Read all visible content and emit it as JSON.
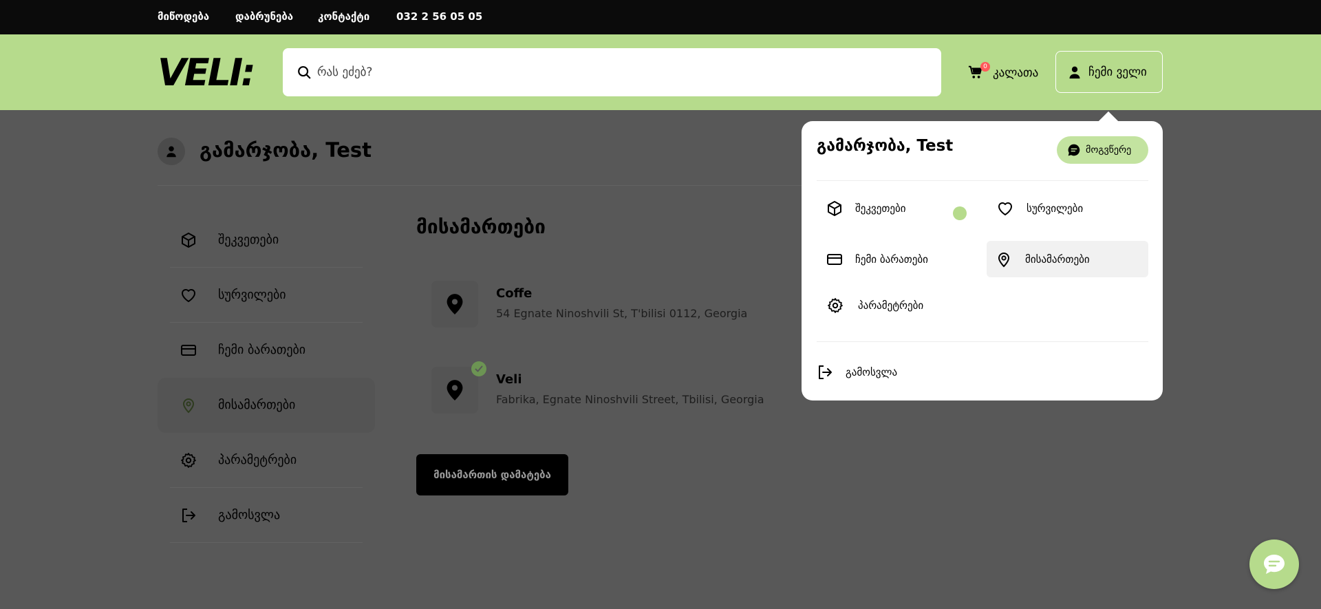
{
  "topbar": {
    "links": [
      "მიწოდება",
      "დაბრუნება",
      "კონტაქტი",
      "032 2 56 05 05"
    ]
  },
  "header": {
    "logo": "VELI:",
    "search_placeholder": "რას ეძებ?",
    "cart_label": "კალათა",
    "cart_count": "0",
    "my_veli_label": "ჩემი ველი"
  },
  "page": {
    "greeting": "გამარჯობა, Test",
    "sidebar": [
      {
        "label": "შეკვეთები",
        "icon": "package-icon"
      },
      {
        "label": "სურვილები",
        "icon": "heart-icon"
      },
      {
        "label": "ჩემი ბარათები",
        "icon": "credit-card-icon"
      },
      {
        "label": "მისამართები",
        "icon": "map-pin-icon",
        "active": true
      },
      {
        "label": "პარამეტრები",
        "icon": "gear-icon"
      },
      {
        "label": "გამოსვლა",
        "icon": "logout-icon"
      }
    ],
    "section_title": "მისამართები",
    "addresses": [
      {
        "name": "Coffe",
        "line": "54 Egnate Ninoshvili St, T'bilisi 0112, Georgia",
        "default": false
      },
      {
        "name": "Veli",
        "line": "Fabrika, Egnate Ninoshvili Street, Tbilisi, Georgia",
        "default": true
      }
    ],
    "add_button": "მისამართის დამატება"
  },
  "dropdown": {
    "greeting": "გამარჯობა, Test",
    "chat_label": "მოგვწერე",
    "items": [
      {
        "label": "შეკვეთები",
        "icon": "package-icon"
      },
      {
        "label": "სურვილები",
        "icon": "heart-icon"
      },
      {
        "label": "ჩემი ბარათები",
        "icon": "credit-card-icon"
      },
      {
        "label": "მისამართები",
        "icon": "map-pin-icon",
        "active": true
      },
      {
        "label": "პარამეტრები",
        "icon": "gear-icon"
      }
    ],
    "logout_label": "გამოსვლა"
  },
  "colors": {
    "brand_green": "#b6db8c",
    "topbar_bg": "#0b0b0b",
    "overlay_bg": "#585858",
    "cart_badge": "#ff5a5a"
  }
}
